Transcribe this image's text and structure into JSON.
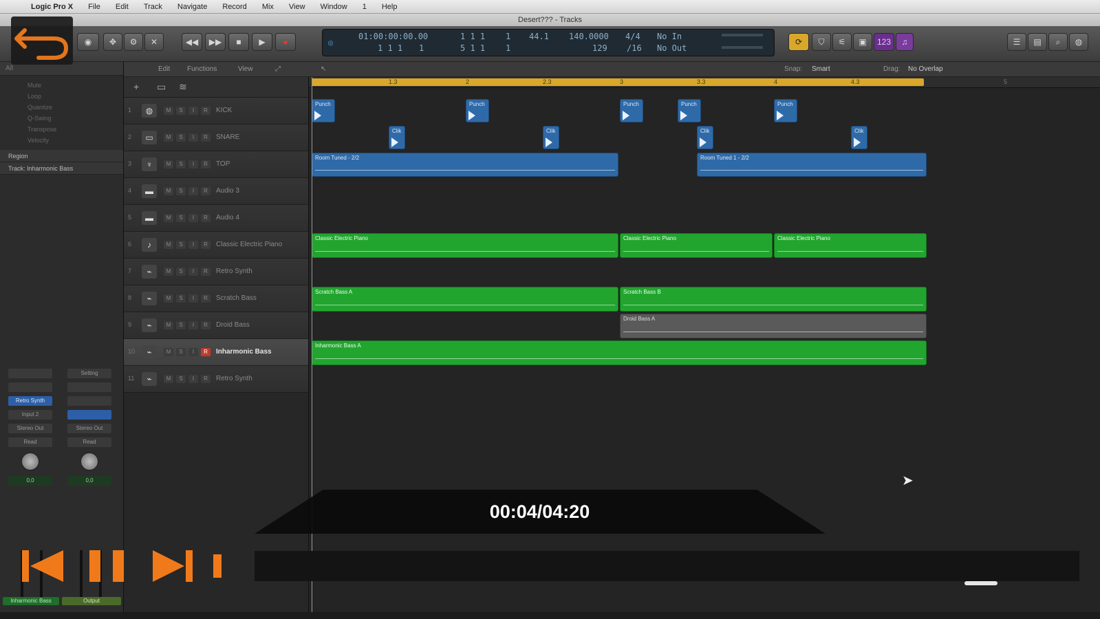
{
  "menubar": {
    "items": [
      "Logic Pro X",
      "File",
      "Edit",
      "Track",
      "Navigate",
      "Record",
      "Mix",
      "View",
      "Window",
      "1",
      "Help"
    ]
  },
  "window": {
    "title": "Desert??? - Tracks"
  },
  "lcd": {
    "smpte": "01:00:00:00.00",
    "bar": "1  1  1",
    "beat": "1",
    "sub": "1  1  1",
    "tick": "1",
    "pos2": "5  1  1",
    "pos2b": "1",
    "sample_rate": "44.1",
    "tempo": "140.0000",
    "tempo2": "129",
    "signature": "4/4",
    "division": "/16",
    "midi_in": "No In",
    "midi_out": "No Out"
  },
  "tracks_toolbar": {
    "edit": "Edit",
    "functions": "Functions",
    "view": "View",
    "snap_label": "Snap:",
    "snap_value": "Smart",
    "drag_label": "Drag:",
    "drag_value": "No Overlap"
  },
  "inspector": {
    "header": "All",
    "lines": [
      "Mute",
      "Loop",
      "Quantize",
      "Q-Swing",
      "Transpose",
      "Velocity"
    ],
    "region_row": "Region",
    "track_row": "Track: Inharmonic Bass",
    "strip1": {
      "plugin": "Retro Synth",
      "send": "Input 2",
      "output": "Stereo Out",
      "mode": "Read",
      "value": "0,0"
    },
    "strip2": {
      "setting": "Setting",
      "send": "",
      "output": "Stereo Out",
      "mode": "Read",
      "value": "0,0"
    },
    "footer_left": "Inharmonic Bass",
    "footer_right": "Output"
  },
  "tracks": [
    {
      "num": "1",
      "name": "KICK",
      "icon": "drum-icon"
    },
    {
      "num": "2",
      "name": "SNARE",
      "icon": "snare-icon"
    },
    {
      "num": "3",
      "name": "TOP",
      "icon": "mic-icon"
    },
    {
      "num": "4",
      "name": "Audio 3",
      "icon": "audio-icon"
    },
    {
      "num": "5",
      "name": "Audio 4",
      "icon": "audio-icon"
    },
    {
      "num": "6",
      "name": "Classic Electric Piano",
      "icon": "piano-icon"
    },
    {
      "num": "7",
      "name": "Retro Synth",
      "icon": "synth-icon"
    },
    {
      "num": "8",
      "name": "Scratch Bass",
      "icon": "synth-icon"
    },
    {
      "num": "9",
      "name": "Droid Bass",
      "icon": "synth-icon"
    },
    {
      "num": "10",
      "name": "Inharmonic Bass",
      "icon": "synth-icon",
      "selected": true
    },
    {
      "num": "11",
      "name": "Retro Synth",
      "icon": "synth-icon"
    }
  ],
  "ruler": {
    "bars": [
      "1.3",
      "2",
      "2.3",
      "3",
      "3.3",
      "4",
      "4.3",
      "5"
    ]
  },
  "regions": {
    "kick": "Punch",
    "snare": "Clik",
    "top1": "Room Tuned - 2/2",
    "top2": "Room Tuned 1 - 2/2",
    "piano1": "Classic Electric Piano",
    "piano2": "Classic Electric Piano",
    "piano3": "Classic Electric Piano",
    "scratch1": "Scratch Bass A",
    "scratch2": "Scratch Bass B",
    "droid": "Droid Bass A",
    "inharmonic": "Inharmonic Bass A"
  },
  "player": {
    "timecode": "00:04/04:20",
    "accent_color": "#f07a1a",
    "progress": 0.015
  }
}
